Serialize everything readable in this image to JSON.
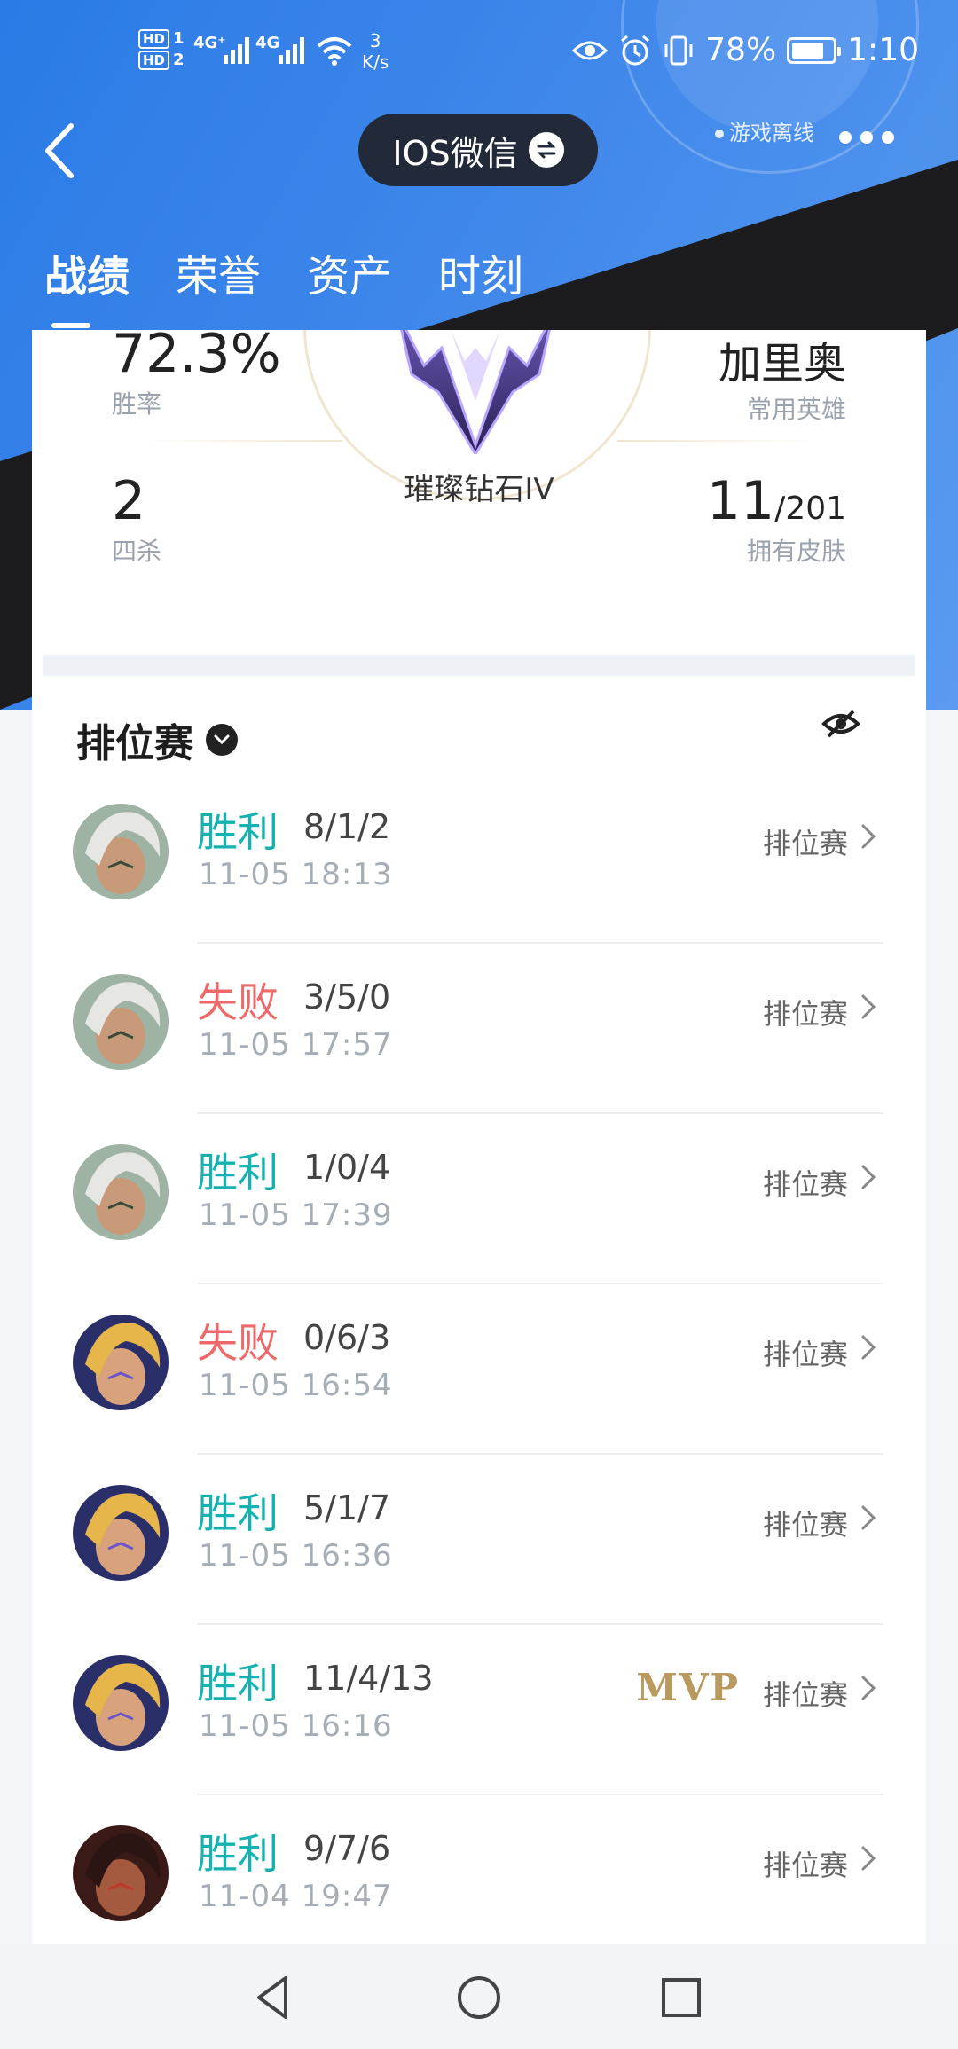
{
  "colors": {
    "win": "#17b2b0",
    "lose": "#ee6a6a",
    "header_blue": "#3f87ea",
    "mvp": "#b89a5e"
  },
  "status_bar": {
    "network1": "4G⁺",
    "network2": "4G",
    "speed_value": "3",
    "speed_unit": "K/s",
    "battery": "78%",
    "time": "1:10",
    "icons": [
      "hd1-icon",
      "hd2-icon",
      "signal-icon",
      "wifi-icon",
      "eye-icon",
      "alarm-icon",
      "vibrate-icon",
      "battery-icon"
    ]
  },
  "nav": {
    "title": "IOS微信",
    "game_status": "游戏离线"
  },
  "tabs": [
    {
      "label": "战绩"
    },
    {
      "label": "荣誉"
    },
    {
      "label": "资产"
    },
    {
      "label": "时刻"
    }
  ],
  "summary": {
    "win_rate": {
      "value": "72.3%",
      "label": "胜率"
    },
    "quadra": {
      "value": "2",
      "label": "四杀"
    },
    "hero": {
      "value": "加里奥",
      "label": "常用英雄"
    },
    "skins": {
      "owned": "11",
      "total": "/201",
      "label": "拥有皮肤"
    },
    "rank": "璀璨钻石IV"
  },
  "section": {
    "title": "排位赛"
  },
  "matches": [
    {
      "result": "胜利",
      "outcome": "win",
      "kda": "8/1/2",
      "time": "11-05 18:13",
      "mode": "排位赛",
      "mvp": "",
      "hero": "white-hair-hero"
    },
    {
      "result": "失败",
      "outcome": "lose",
      "kda": "3/5/0",
      "time": "11-05 17:57",
      "mode": "排位赛",
      "mvp": "",
      "hero": "white-hair-hero"
    },
    {
      "result": "胜利",
      "outcome": "win",
      "kda": "1/0/4",
      "time": "11-05 17:39",
      "mode": "排位赛",
      "mvp": "",
      "hero": "white-hair-hero"
    },
    {
      "result": "失败",
      "outcome": "lose",
      "kda": "0/6/3",
      "time": "11-05 16:54",
      "mode": "排位赛",
      "mvp": "",
      "hero": "golden-hair-hero"
    },
    {
      "result": "胜利",
      "outcome": "win",
      "kda": "5/1/7",
      "time": "11-05 16:36",
      "mode": "排位赛",
      "mvp": "",
      "hero": "golden-hair-hero"
    },
    {
      "result": "胜利",
      "outcome": "win",
      "kda": "11/4/13",
      "time": "11-05 16:16",
      "mode": "排位赛",
      "mvp": "MVP",
      "hero": "golden-hair-hero"
    },
    {
      "result": "胜利",
      "outcome": "win",
      "kda": "9/7/6",
      "time": "11-04 19:47",
      "mode": "排位赛",
      "mvp": "",
      "hero": "dark-warrior-hero"
    }
  ],
  "bottom_nav": [
    "back-nav-icon",
    "home-nav-icon",
    "recent-apps-icon"
  ]
}
